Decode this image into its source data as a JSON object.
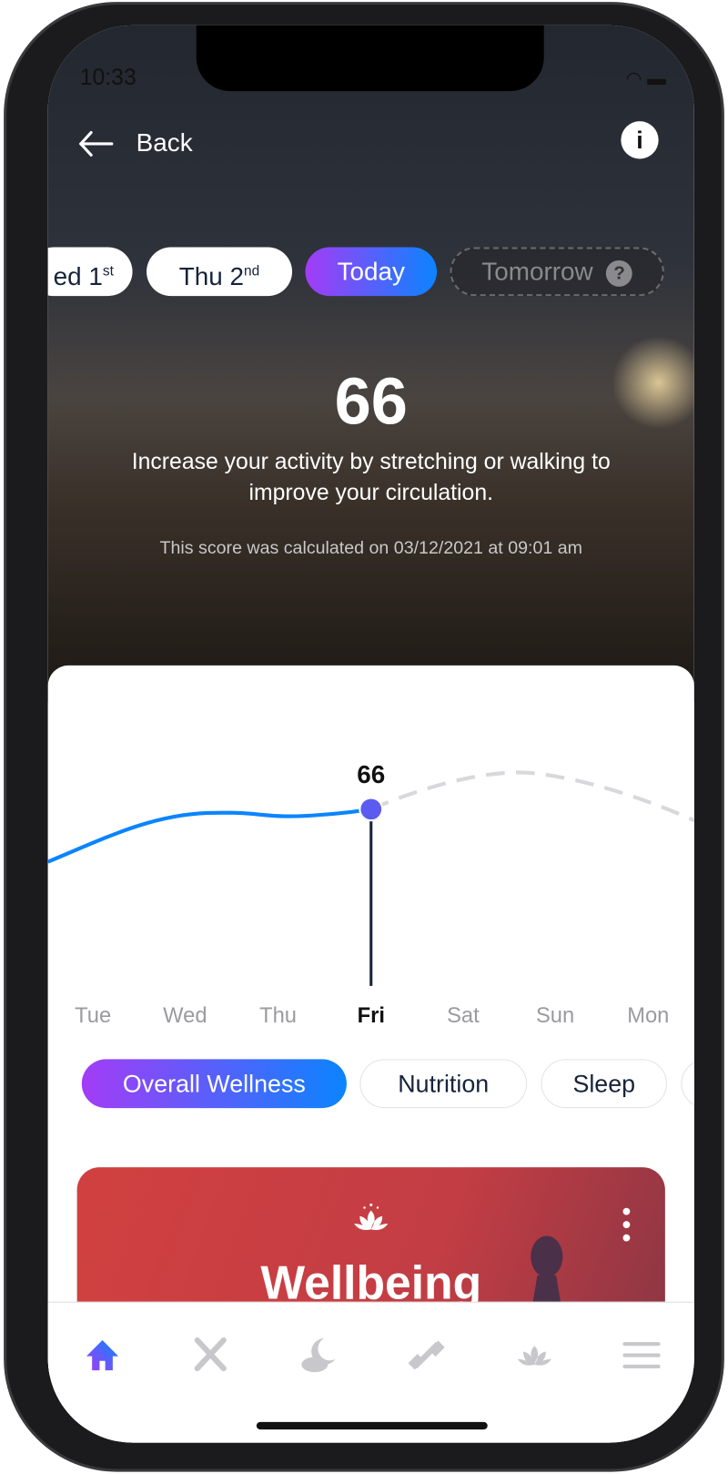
{
  "status_bar": {
    "time": "10:33"
  },
  "header": {
    "back_label": "Back",
    "info_icon": "info-icon"
  },
  "date_pills": [
    {
      "label": "ed 1",
      "sup": "st"
    },
    {
      "label": "Thu 2",
      "sup": "nd"
    },
    {
      "label": "Today"
    },
    {
      "label": "Tomorrow",
      "help": "?"
    }
  ],
  "score": {
    "value": "66",
    "message": "Increase your activity by stretching or walking to improve your circulation.",
    "calculated": "This score was calculated on 03/12/2021 at 09:01 am"
  },
  "chart_data": {
    "type": "line",
    "categories": [
      "Tue",
      "Wed",
      "Thu",
      "Fri",
      "Sat",
      "Sun",
      "Mon"
    ],
    "selected": "Fri",
    "selected_label": "66",
    "series": [
      {
        "style": "actual",
        "color": "#0b84ff"
      },
      {
        "style": "forecast",
        "color": "#d8d8dc"
      }
    ]
  },
  "categories": [
    "Overall Wellness",
    "Nutrition",
    "Sleep"
  ],
  "wellbeing_card": {
    "title": "Wellbeing"
  },
  "tabs": [
    "home",
    "nutrition",
    "sleep",
    "fitness",
    "wellbeing",
    "menu"
  ],
  "colors": {
    "accent_start": "#a33cf5",
    "accent_end": "#0b84ff",
    "card": "#d14040"
  }
}
